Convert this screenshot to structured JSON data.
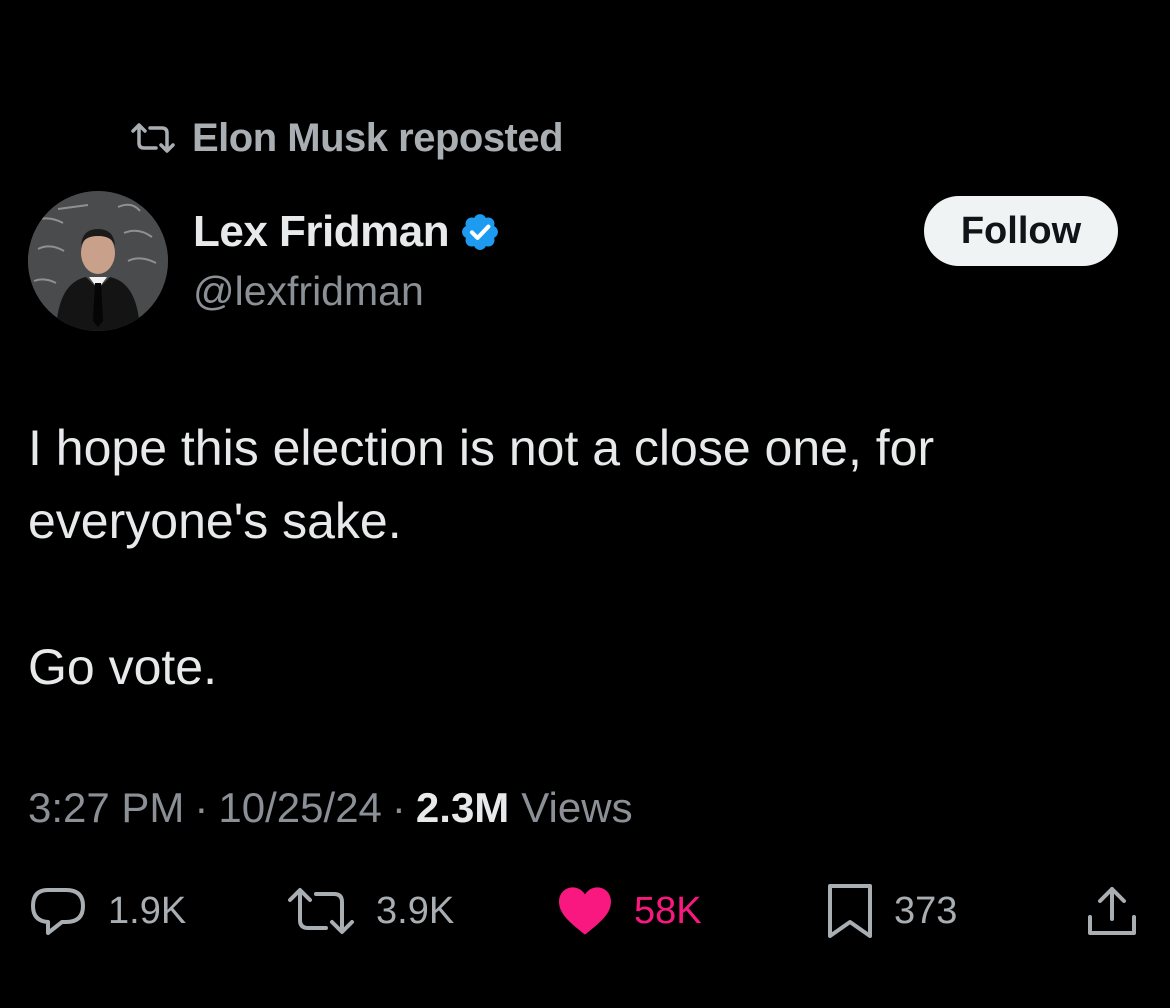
{
  "repost": {
    "label": "Elon Musk reposted"
  },
  "author": {
    "name": "Lex Fridman",
    "handle": "@lexfridman",
    "verified": true,
    "avatar_icon": "avatar-photo"
  },
  "follow_label": "Follow",
  "post": {
    "paragraphs": [
      "I hope this election is not a close one, for everyone's sake.",
      "Go vote."
    ]
  },
  "meta": {
    "time": "3:27 PM",
    "date": "10/25/24",
    "views_count": "2.3M",
    "views_label": "Views"
  },
  "actions": {
    "replies": "1.9K",
    "reposts": "3.9K",
    "likes": "58K",
    "bookmarks": "373"
  },
  "colors": {
    "background": "#000000",
    "text": "#e7e9ea",
    "secondary": "#8b9096",
    "like": "#f91880",
    "verified": "#1d9bf0",
    "follow_bg": "#eff3f4"
  }
}
